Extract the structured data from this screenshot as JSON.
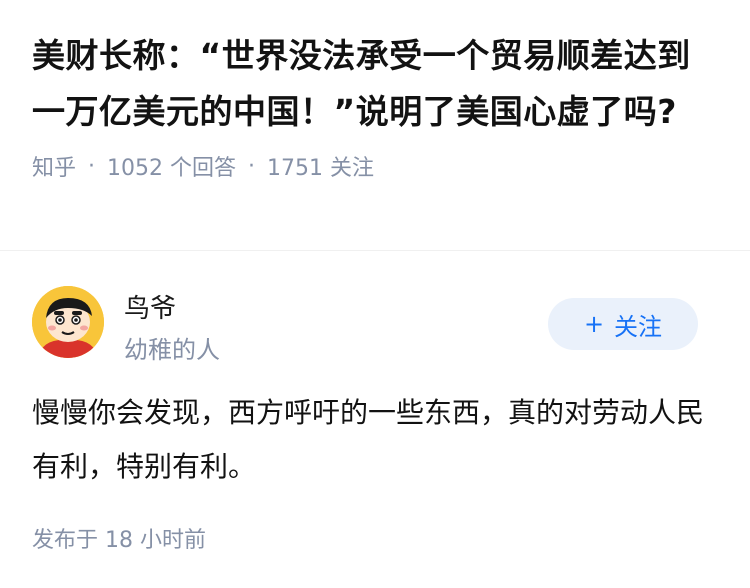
{
  "question": {
    "title": "美财长称：“世界没法承受一个贸易顺差达到一万亿美元的中国！”说明了美国心虚了吗?",
    "source": "知乎",
    "answer_count": "1052 个回答",
    "follower_count": "1751 关注",
    "separator": "·"
  },
  "answer": {
    "author_name": "鸟爷",
    "author_bio": "幼稚的人",
    "follow_icon": "+",
    "follow_label": "关注",
    "content": "慢慢你会发现，西方呼吁的一些东西，真的对劳动人民有利，特别有利。",
    "time": "发布于 18 小时前",
    "avatar_icon": "crayon-shinchan-avatar",
    "accent_color": "#1772f6"
  }
}
